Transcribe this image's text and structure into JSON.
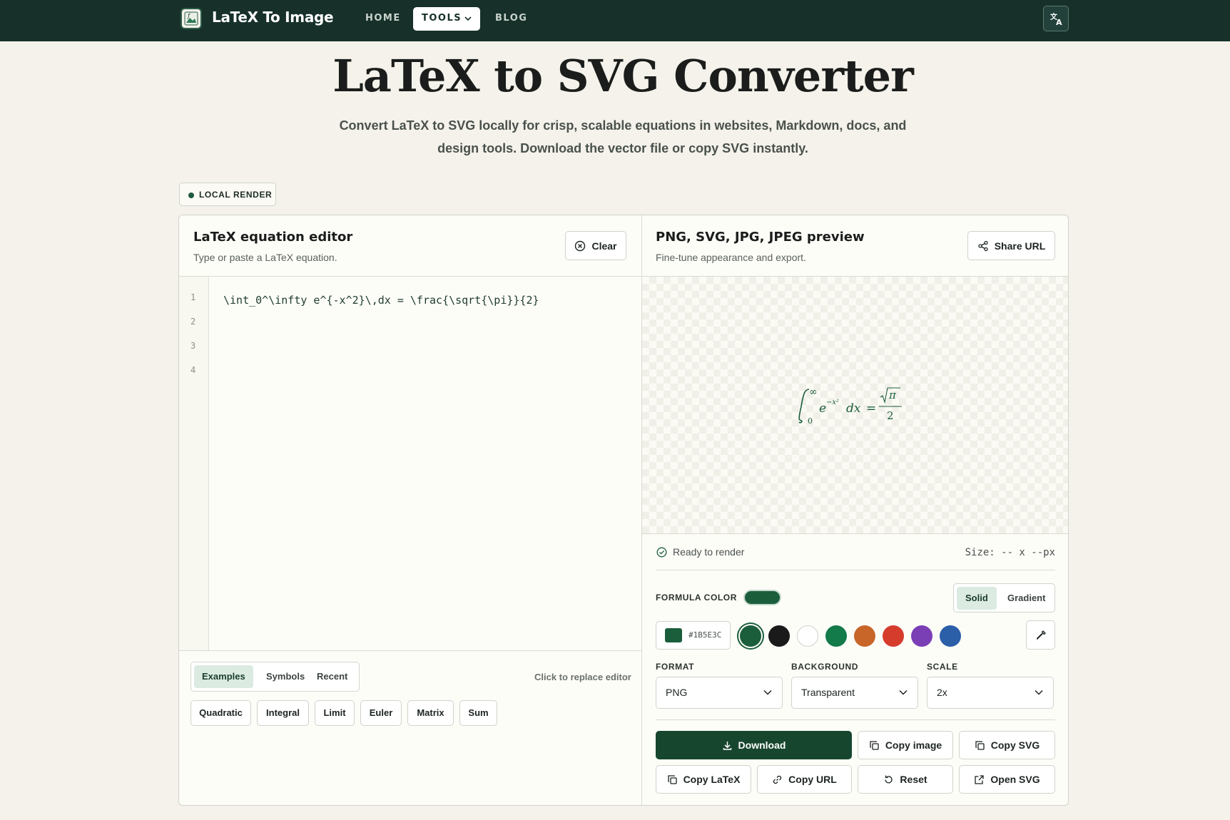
{
  "nav": {
    "brand": "LaTeX To Image",
    "links": {
      "home": "HOME",
      "tools": "TOOLS",
      "blog": "BLOG"
    },
    "language_icon": "translate-icon"
  },
  "hero": {
    "title": "LaTeX to SVG Converter",
    "subtitle": "Convert LaTeX to SVG locally for crisp, scalable equations in websites, Markdown, docs, and design tools. Download the vector file or copy SVG instantly."
  },
  "badge": {
    "label": "LOCAL RENDER"
  },
  "editor": {
    "title": "LaTeX equation editor",
    "subtitle": "Type or paste a LaTeX equation.",
    "clear_label": "Clear",
    "line_numbers": [
      "1",
      "2",
      "3",
      "4"
    ],
    "code": "\\int_0^\\infty e^{-x^2}\\,dx = \\frac{\\sqrt{\\pi}}{2}",
    "tabs": {
      "examples": "Examples",
      "symbols": "Symbols",
      "recent": "Recent"
    },
    "replace_hint": "Click to replace editor",
    "chips": {
      "quadratic": "Quadratic",
      "integral": "Integral",
      "limit": "Limit",
      "euler": "Euler",
      "matrix": "Matrix",
      "sum": "Sum"
    }
  },
  "preview": {
    "title": "PNG, SVG, JPG, JPEG preview",
    "subtitle": "Fine-tune appearance and export.",
    "share_label": "Share URL",
    "status": "Ready to render",
    "size": "Size: -- x --px",
    "formula_color_label": "FORMULA COLOR",
    "color_mode": {
      "solid": "Solid",
      "gradient": "Gradient"
    },
    "hex_value": "#1B5E3C",
    "swatches": [
      "#1b5e3c",
      "#1a1a1a",
      "#ffffff",
      "#137a4a",
      "#c8662a",
      "#d63c2c",
      "#7b3fb5",
      "#2b5fa8"
    ],
    "format_label": "FORMAT",
    "format_value": "PNG",
    "background_label": "BACKGROUND",
    "background_value": "Transparent",
    "scale_label": "SCALE",
    "scale_value": "2x",
    "actions": {
      "download": "Download",
      "copy_image": "Copy image",
      "copy_svg": "Copy SVG",
      "copy_latex": "Copy LaTeX",
      "copy_url": "Copy URL",
      "reset": "Reset",
      "open_svg": "Open SVG"
    }
  },
  "colors": {
    "nav_bg": "#17312a",
    "accent": "#1b5e3c",
    "primary_button": "#17462f",
    "page_bg": "#f4f2ea"
  }
}
